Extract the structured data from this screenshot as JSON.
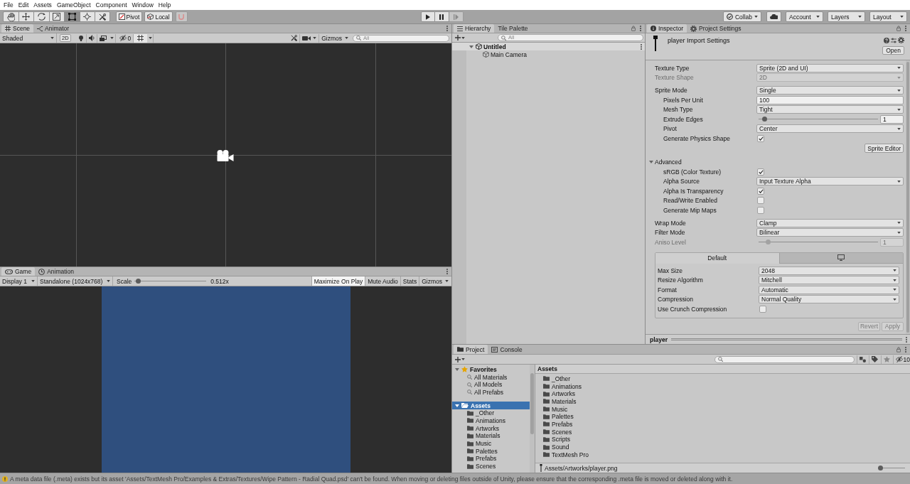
{
  "menu_bar": [
    "File",
    "Edit",
    "Assets",
    "GameObject",
    "Component",
    "Window",
    "Help"
  ],
  "toolbar": {
    "tools": [
      {
        "kind": "hand",
        "selected": false
      },
      {
        "kind": "move",
        "selected": false
      },
      {
        "kind": "rotate",
        "selected": false
      },
      {
        "kind": "scale",
        "selected": false
      },
      {
        "kind": "rect",
        "selected": true
      },
      {
        "kind": "transform",
        "selected": false
      },
      {
        "kind": "custom",
        "selected": false
      }
    ],
    "handle_buttons": [
      {
        "kind": "pivot",
        "label": "Pivot"
      },
      {
        "kind": "local",
        "label": "Local"
      }
    ],
    "collab": "Collab",
    "menus": [
      "Account",
      "Layers",
      "Layout"
    ]
  },
  "scene_panel": {
    "tabs": [
      {
        "kind": "scene",
        "label": "Scene",
        "selected": true
      },
      {
        "kind": "animator",
        "label": "Animator",
        "selected": false
      }
    ],
    "shading": "Shaded",
    "mode_button": "2D",
    "hidden_count": "0",
    "grid_on": true,
    "gizmos": "Gizmos",
    "search_placeholder": "All"
  },
  "game_panel": {
    "tabs": [
      {
        "kind": "game",
        "label": "Game",
        "selected": true
      },
      {
        "kind": "animation",
        "label": "Animation",
        "selected": false
      }
    ],
    "display": "Display 1",
    "resolution": "Standalone (1024x768)",
    "scale_label": "Scale",
    "scale_slider": {
      "level": 0.02
    },
    "scale_value": "0.512x",
    "toggles": [
      {
        "label": "Maximize On Play",
        "on": true
      },
      {
        "label": "Mute Audio",
        "on": false
      },
      {
        "label": "Stats",
        "on": false
      }
    ],
    "gizmos": "Gizmos"
  },
  "hierarchy": {
    "tabs": [
      {
        "kind": "hierarchy",
        "label": "Hierarchy",
        "selected": true
      },
      {
        "kind": "palette",
        "label": "Tile Palette",
        "selected": false
      }
    ],
    "search_placeholder": "All",
    "tree": [
      {
        "kind": "scene",
        "label": "Untitled",
        "expanded": true,
        "selected": false,
        "children": [
          {
            "kind": "object",
            "label": "Main Camera",
            "selected": false
          }
        ]
      }
    ]
  },
  "inspector": {
    "tabs": [
      {
        "kind": "inspector",
        "label": "Inspector",
        "selected": true
      },
      {
        "kind": "settings",
        "label": "Project Settings",
        "selected": false
      }
    ],
    "title": "player Import Settings",
    "open_button": "Open",
    "sections": [
      [
        {
          "kind": "dropdown",
          "label": "Texture Type",
          "value": "Sprite (2D and UI)",
          "disabled": false
        },
        {
          "kind": "dropdown",
          "label": "Texture Shape",
          "value": "2D",
          "disabled": true
        }
      ],
      [
        {
          "kind": "dropdown",
          "label": "Sprite Mode",
          "value": "Single",
          "disabled": false,
          "children": [
            {
              "kind": "text",
              "label": "Pixels Per Unit",
              "value": "100",
              "disabled": false
            },
            {
              "kind": "dropdown",
              "label": "Mesh Type",
              "value": "Tight",
              "disabled": false
            },
            {
              "kind": "slider",
              "label": "Extrude Edges",
              "level": 0.03,
              "value": "1",
              "disabled": false
            },
            {
              "kind": "dropdown",
              "label": "Pivot",
              "value": "Center",
              "disabled": false
            },
            {
              "kind": "checkbox",
              "label": "Generate Physics Shape",
              "checked": true,
              "disabled": false
            }
          ]
        },
        {
          "kind": "button",
          "label": "Sprite Editor",
          "disabled": false
        }
      ],
      [
        {
          "kind": "foldout",
          "label": "Advanced",
          "expanded": true,
          "disabled": false,
          "children": [
            {
              "kind": "checkbox",
              "label": "sRGB (Color Texture)",
              "checked": true,
              "disabled": false
            },
            {
              "kind": "dropdown",
              "label": "Alpha Source",
              "value": "Input Texture Alpha",
              "disabled": false
            },
            {
              "kind": "checkbox",
              "label": "Alpha Is Transparency",
              "checked": true,
              "disabled": false
            },
            {
              "kind": "checkbox",
              "label": "Read/Write Enabled",
              "checked": false,
              "disabled": false
            },
            {
              "kind": "checkbox",
              "label": "Generate Mip Maps",
              "checked": false,
              "disabled": false
            }
          ]
        }
      ],
      [
        {
          "kind": "dropdown",
          "label": "Wrap Mode",
          "value": "Clamp",
          "disabled": false
        },
        {
          "kind": "dropdown",
          "label": "Filter Mode",
          "value": "Bilinear",
          "disabled": false
        },
        {
          "kind": "slider",
          "label": "Aniso Level",
          "level": 0.06,
          "value": "1",
          "disabled": true
        }
      ]
    ],
    "platform_tabs": [
      {
        "kind": "default",
        "label": "Default",
        "selected": true
      },
      {
        "kind": "standalone",
        "selected": false
      }
    ],
    "platform_settings": [
      {
        "kind": "dropdown",
        "label": "Max Size",
        "value": "2048",
        "disabled": false
      },
      {
        "kind": "dropdown",
        "label": "Resize Algorithm",
        "value": "Mitchell",
        "disabled": false
      },
      {
        "kind": "dropdown",
        "label": "Format",
        "value": "Automatic",
        "disabled": false
      },
      {
        "kind": "dropdown",
        "label": "Compression",
        "value": "Normal Quality",
        "disabled": false
      },
      {
        "kind": "checkbox",
        "label": "Use Crunch Compression",
        "checked": false,
        "disabled": false
      }
    ],
    "footer_buttons": [
      {
        "label": "Revert",
        "disabled": true
      },
      {
        "label": "Apply",
        "disabled": true
      }
    ],
    "preview_title": "player"
  },
  "project": {
    "tabs": [
      {
        "kind": "project",
        "label": "Project",
        "selected": true
      },
      {
        "kind": "console",
        "label": "Console",
        "selected": false
      }
    ],
    "hidden_count": "10",
    "tree": [
      {
        "kind": "favorites",
        "label": "Favorites",
        "expanded": true,
        "selected": false,
        "children": [
          {
            "kind": "search",
            "label": "All Materials",
            "selected": false
          },
          {
            "kind": "search",
            "label": "All Models",
            "selected": false
          },
          {
            "kind": "search",
            "label": "All Prefabs",
            "selected": false
          }
        ]
      },
      {
        "kind": "root",
        "label": "Assets",
        "expanded": true,
        "selected": true,
        "children": [
          {
            "kind": "folder",
            "label": "_Other",
            "selected": false
          },
          {
            "kind": "folder",
            "label": "Animations",
            "selected": false
          },
          {
            "kind": "folder",
            "label": "Artworks",
            "selected": false
          },
          {
            "kind": "folder",
            "label": "Materials",
            "selected": false
          },
          {
            "kind": "folder",
            "label": "Music",
            "selected": false
          },
          {
            "kind": "folder",
            "label": "Palettes",
            "selected": false
          },
          {
            "kind": "folder",
            "label": "Prefabs",
            "selected": false
          },
          {
            "kind": "folder",
            "label": "Scenes",
            "selected": false
          }
        ]
      }
    ],
    "content_title": "Assets",
    "folders": [
      {
        "label": "_Other",
        "selected": false
      },
      {
        "label": "Animations",
        "selected": false
      },
      {
        "label": "Artworks",
        "selected": false
      },
      {
        "label": "Materials",
        "selected": false
      },
      {
        "label": "Music",
        "selected": false
      },
      {
        "label": "Palettes",
        "selected": false
      },
      {
        "label": "Prefabs",
        "selected": false
      },
      {
        "label": "Scenes",
        "selected": false
      },
      {
        "label": "Scripts",
        "selected": false
      },
      {
        "label": "Sound",
        "selected": false
      },
      {
        "label": "TextMesh Pro",
        "selected": false
      }
    ],
    "selected_path": "Assets/Artworks/player.png",
    "zoom_slider": {
      "level": 0
    }
  },
  "status_bar": {
    "kind": "warning",
    "message": "A meta data file (.meta) exists but its asset 'Assets/TextMesh Pro/Examples & Extras/Textures/Wipe Pattern - Radial Quad.psd' can't be found. When moving or deleting files outside of Unity, please ensure that the corresponding .meta file is moved or deleted along with it."
  }
}
